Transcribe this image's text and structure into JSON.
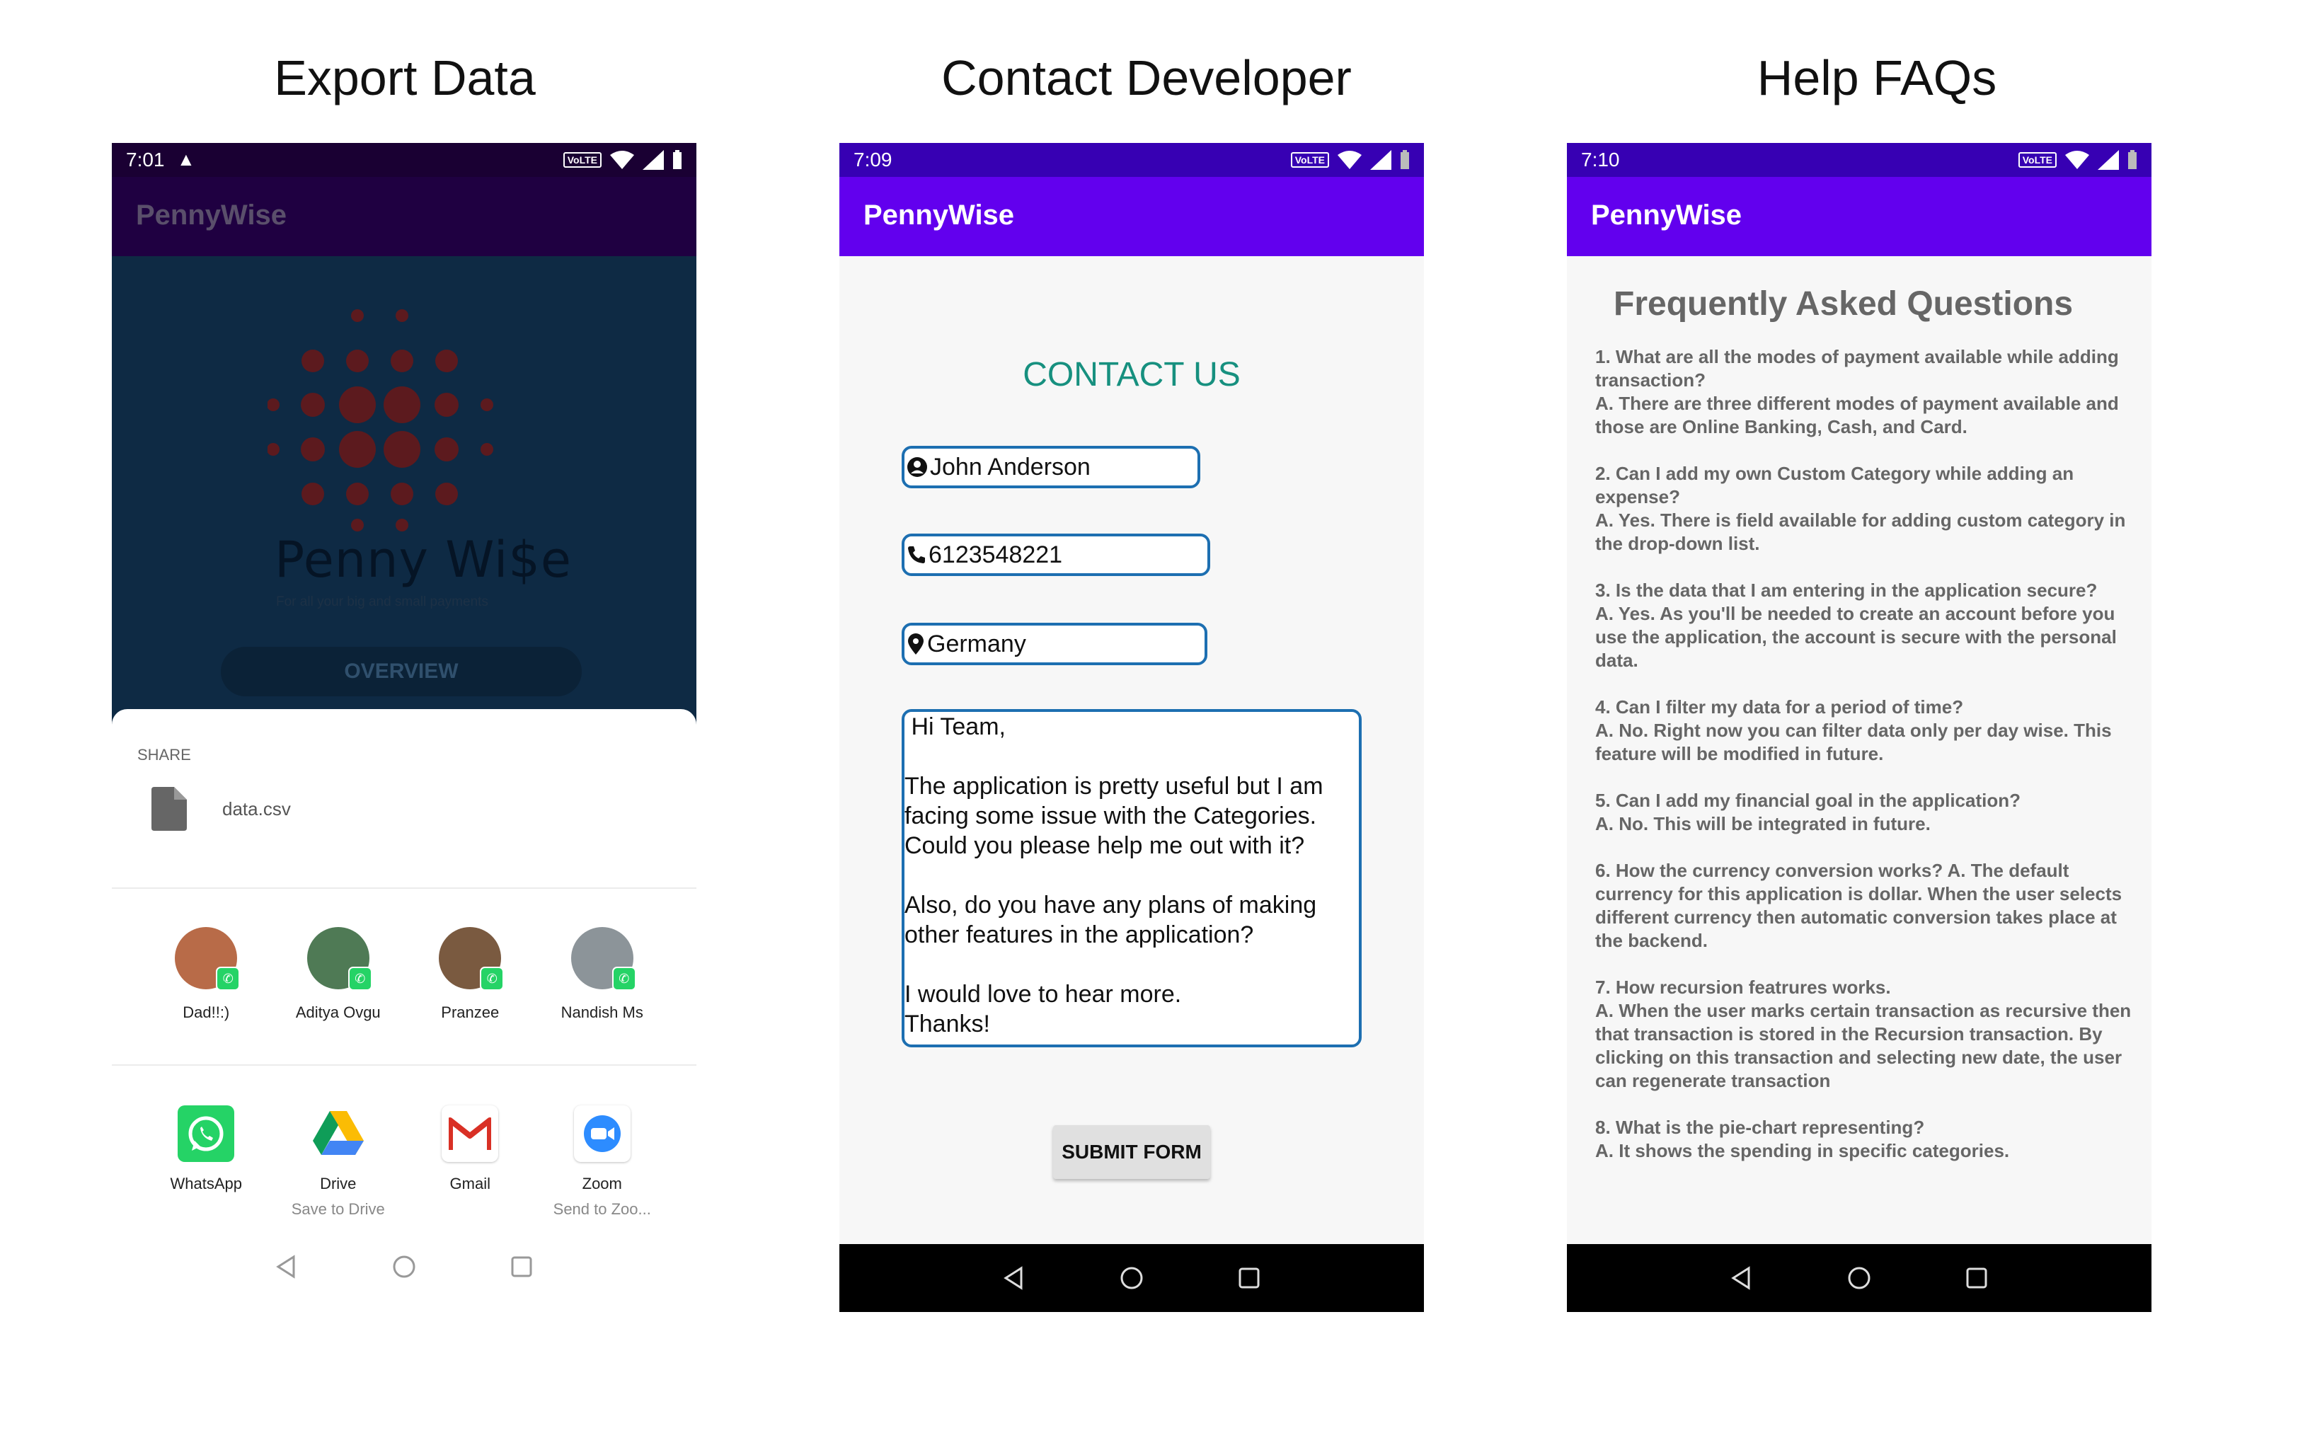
{
  "titles": {
    "export": "Export Data",
    "contact": "Contact Developer",
    "faq": "Help FAQs"
  },
  "app_name": "PennyWise",
  "colors": {
    "app_bar": "#6200ee",
    "status_bar": "#3700b3",
    "accent_teal": "#17907f",
    "field_border": "#1d6fb1"
  },
  "export_screen": {
    "time": "7:01",
    "logo_text": "Penny Wi$e",
    "logo_tagline": "For all your big and small payments",
    "overview_button": "OVERVIEW",
    "share_label": "SHARE",
    "file_name": "data.csv",
    "contacts": [
      {
        "name": "Dad!!:)"
      },
      {
        "name": "Aditya Ovgu"
      },
      {
        "name": "Pranzee"
      },
      {
        "name": "Nandish Ms"
      }
    ],
    "apps": [
      {
        "name": "WhatsApp",
        "sub": "",
        "icon": "whatsapp-icon"
      },
      {
        "name": "Drive",
        "sub": "Save to Drive",
        "icon": "drive-icon"
      },
      {
        "name": "Gmail",
        "sub": "",
        "icon": "gmail-icon"
      },
      {
        "name": "Zoom",
        "sub": "Send to Zoo...",
        "icon": "zoom-icon"
      }
    ]
  },
  "contact_screen": {
    "time": "7:09",
    "heading": "CONTACT US",
    "name_value": "John Anderson",
    "phone_value": "6123548221",
    "country_value": "Germany",
    "message_value": " Hi Team,\n\nThe application is pretty useful but I am\nfacing some issue with the Categories.\nCould you please help me out with it?\n\nAlso, do you have any plans of making\nother features in the application?\n\nI would love to hear more.\nThanks!",
    "submit_button": "SUBMIT FORM"
  },
  "faq_screen": {
    "time": "7:10",
    "heading": "Frequently Asked Questions",
    "items": [
      {
        "q": "1. What are all the modes of payment available while adding transaction?",
        "a": " A. There are three different modes of payment available and those are Online Banking, Cash, and Card."
      },
      {
        "q": "  2. Can I add my own Custom Category while adding an expense?",
        "a": " A. Yes. There is field available for adding custom category in the drop-down list."
      },
      {
        "q": "  3. Is the data that I am entering in the application secure?",
        "a": "  A. Yes. As you'll be needed to create an account before you use the application, the account is secure with the personal data."
      },
      {
        "q": "  4. Can I filter my data for a period of time?",
        "a": "  A. No. Right now you can filter data only per day wise. This feature will be modified in future."
      },
      {
        "q": "  5. Can I add my financial goal in the application?",
        "a": "  A. No. This will be integrated in future."
      },
      {
        "q": "  6. How the currency conversion works? A. The default currency for this application is dollar. When the user selects different currency then automatic conversion takes place at the backend.",
        "a": ""
      },
      {
        "q": "  7. How recursion featrures works.",
        "a": "  A. When the user marks certain transaction as recursive then that transaction is stored in the Recursion transaction. By clicking on this transaction and selecting new date, the user can regenerate transaction"
      },
      {
        "q": "  8. What is the pie-chart representing?",
        "a": "  A. It shows the spending in specific categories."
      }
    ]
  }
}
